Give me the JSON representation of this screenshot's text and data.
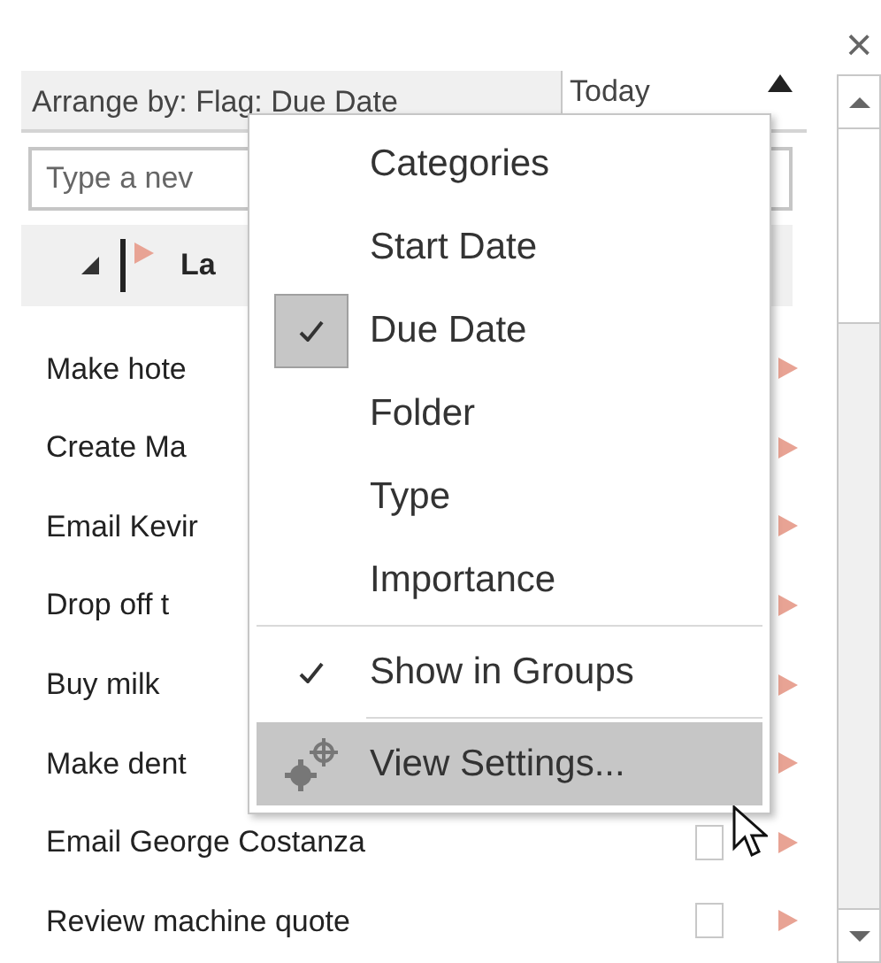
{
  "close_label": "×",
  "arrange": {
    "label": "Arrange by: Flag: Due Date",
    "sort": "Today"
  },
  "new_task": {
    "placeholder": "Type a nev"
  },
  "group": {
    "label": "La",
    "expanded": true
  },
  "tasks": [
    {
      "title": "Make hote"
    },
    {
      "title": "Create Ma"
    },
    {
      "title": "Email Kevir"
    },
    {
      "title": "Drop off t"
    },
    {
      "title": "Buy milk"
    },
    {
      "title": "Make dent"
    },
    {
      "title": "Email George Costanza",
      "checked": false
    },
    {
      "title": "Review machine quote",
      "checked": false
    }
  ],
  "menu": [
    {
      "label": "Categories",
      "kind": "radio",
      "checked": false,
      "selected": false,
      "separator_before": false
    },
    {
      "label": "Start Date",
      "kind": "radio",
      "checked": false,
      "selected": false,
      "separator_before": false
    },
    {
      "label": "Due Date",
      "kind": "radio",
      "checked": true,
      "selected": false,
      "separator_before": false
    },
    {
      "label": "Folder",
      "kind": "radio",
      "checked": false,
      "selected": false,
      "separator_before": false
    },
    {
      "label": "Type",
      "kind": "radio",
      "checked": false,
      "selected": false,
      "separator_before": false
    },
    {
      "label": "Importance",
      "kind": "radio",
      "checked": false,
      "selected": false,
      "separator_before": false
    },
    {
      "label": "Show in Groups",
      "kind": "toggle",
      "checked": true,
      "selected": false,
      "separator_before": true
    },
    {
      "label": "View Settings...",
      "kind": "command",
      "selected": true,
      "separator_before": true
    }
  ]
}
